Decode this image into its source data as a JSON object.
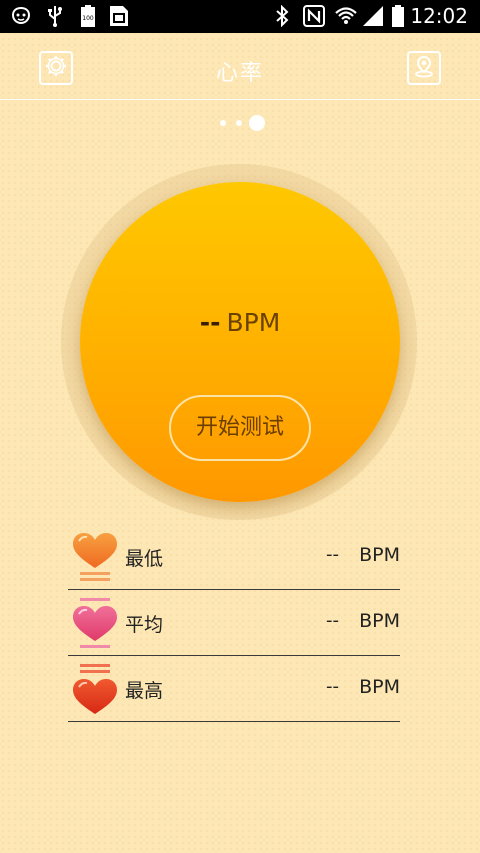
{
  "status_bar": {
    "time": "12:02",
    "battery_level": "100",
    "icons": [
      "cat-icon",
      "usb-icon",
      "battery-100-icon",
      "sim-icon",
      "bluetooth-icon",
      "nfc-icon",
      "wifi-icon",
      "signal-icon",
      "battery-icon"
    ]
  },
  "header": {
    "title": "心率",
    "left_icon": "settings-icon",
    "right_icon": "location-icon"
  },
  "pager": {
    "count": 3,
    "active_index": 2
  },
  "measure": {
    "value": "--",
    "unit": "BPM",
    "start_label": "开始测试"
  },
  "stats": [
    {
      "label": "最低",
      "value": "--",
      "unit": "BPM",
      "icon": "heart-min-icon",
      "color": "#f07a2a"
    },
    {
      "label": "平均",
      "value": "--",
      "unit": "BPM",
      "icon": "heart-avg-icon",
      "color": "#e84a7a"
    },
    {
      "label": "最高",
      "value": "--",
      "unit": "BPM",
      "icon": "heart-max-icon",
      "color": "#e8321e"
    }
  ],
  "colors": {
    "background": "#fde7b4",
    "circle_top": "#ffc800",
    "circle_bottom": "#ff9800"
  }
}
